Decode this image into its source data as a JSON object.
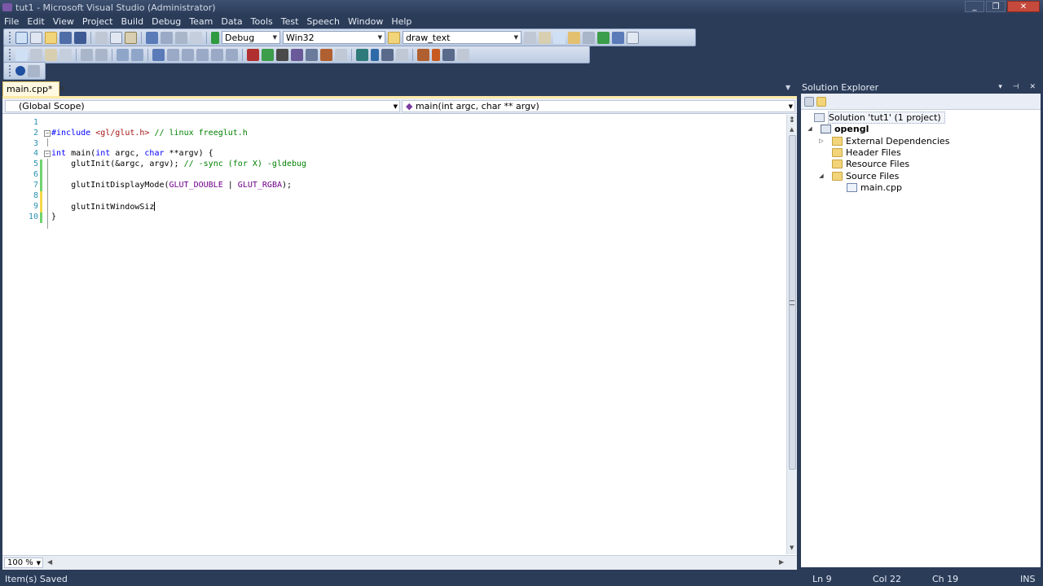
{
  "window": {
    "title": "tut1 - Microsoft Visual Studio (Administrator)",
    "controls": [
      "_",
      "❐",
      "✕"
    ]
  },
  "menu": [
    "File",
    "Edit",
    "View",
    "Project",
    "Build",
    "Debug",
    "Team",
    "Data",
    "Tools",
    "Test",
    "Speech",
    "Window",
    "Help"
  ],
  "toolbar": {
    "configuration": "Debug",
    "platform": "Win32",
    "find_box": "draw_text"
  },
  "editor": {
    "tab_label": "main.cpp*",
    "tab_close": "✕",
    "scope": "(Global Scope)",
    "function": "main(int argc, char ** argv)",
    "zoom": "100 %",
    "line_numbers": [
      "1",
      "2",
      "3",
      "4",
      "5",
      "6",
      "7",
      "8",
      "9",
      "10"
    ],
    "lines": {
      "l2": {
        "pp": "#include",
        "inc": " <gl/glut.h>",
        "cm": " // linux freeglut.h"
      },
      "l4": {
        "kw1": "int",
        "t1": " main(",
        "kw2": "int",
        "t2": " argc, ",
        "kw3": "char",
        "t3": " **argv) {"
      },
      "l5": {
        "t1": "    glutInit(&argc, argv);",
        "cm": " // -sync (for X) -gldebug"
      },
      "l7": {
        "t1": "    glutInitDisplayMode(",
        "mac1": "GLUT_DOUBLE",
        "t2": " | ",
        "mac2": "GLUT_RGBA",
        "t3": ");"
      },
      "l9": {
        "t1": "    glutInitWindowSiz"
      },
      "l10": {
        "t1": "}"
      }
    }
  },
  "solution_explorer": {
    "title": "Solution Explorer",
    "header_controls": "▾ ⊣ ✕",
    "items": [
      {
        "label": "Solution 'tut1' (1 project)"
      },
      {
        "label": "opengl"
      },
      {
        "label": "External Dependencies"
      },
      {
        "label": "Header Files"
      },
      {
        "label": "Resource Files"
      },
      {
        "label": "Source Files"
      },
      {
        "label": "main.cpp"
      }
    ]
  },
  "status": {
    "message": "Item(s) Saved",
    "ln": "Ln 9",
    "col": "Col 22",
    "ch": "Ch 19",
    "mode": "INS"
  },
  "colors": {
    "chrome": "#2b3c59",
    "keyword": "#0000ff",
    "comment": "#008000",
    "string": "#a31515",
    "macro": "#6f008a",
    "line_number": "#2b91af",
    "changed_bar": "#6fd36f"
  }
}
